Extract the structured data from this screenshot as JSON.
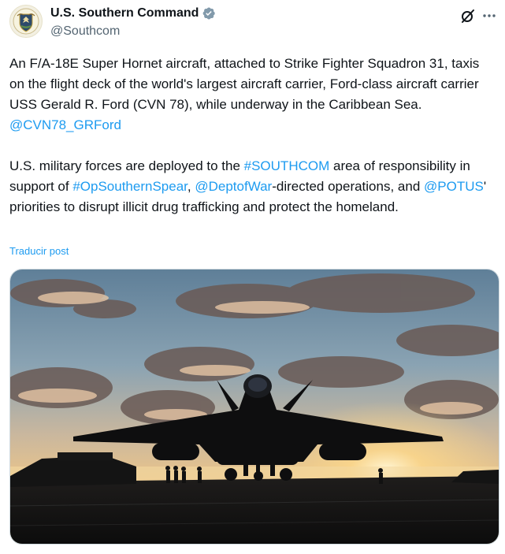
{
  "author": {
    "display_name": "U.S. Southern Command",
    "handle": "@Southcom",
    "verified": true,
    "avatar_icon": "southcom-seal-icon"
  },
  "actions": {
    "grok_icon": "grok-icon",
    "more_icon": "more-options-icon"
  },
  "post": {
    "p1_text_1": "An F/A-18E Super Hornet aircraft, attached to Strike Fighter Squadron 31, taxis on the flight deck of the world's largest aircraft carrier, Ford-class aircraft carrier USS Gerald R. Ford (CVN 78), while underway in the Caribbean Sea. ",
    "p1_mention": "@CVN78_GRFord",
    "p2_text_1": "U.S. military forces are deployed to the ",
    "p2_hashtag_1": "#SOUTHCOM",
    "p2_text_2": " area of responsibility in support of ",
    "p2_hashtag_2": "#OpSouthernSpear",
    "p2_text_3": ", ",
    "p2_mention_1": "@DeptofWar",
    "p2_text_4": "-directed operations, and ",
    "p2_mention_2": "@POTUS",
    "p2_text_5": "' priorities to disrupt illicit drug trafficking and protect the homeland.",
    "translate_label": "Traducir post"
  },
  "colors": {
    "link": "#1d9bf0",
    "text": "#0f1419",
    "secondary": "#536471",
    "verified_badge": "#829aab"
  }
}
